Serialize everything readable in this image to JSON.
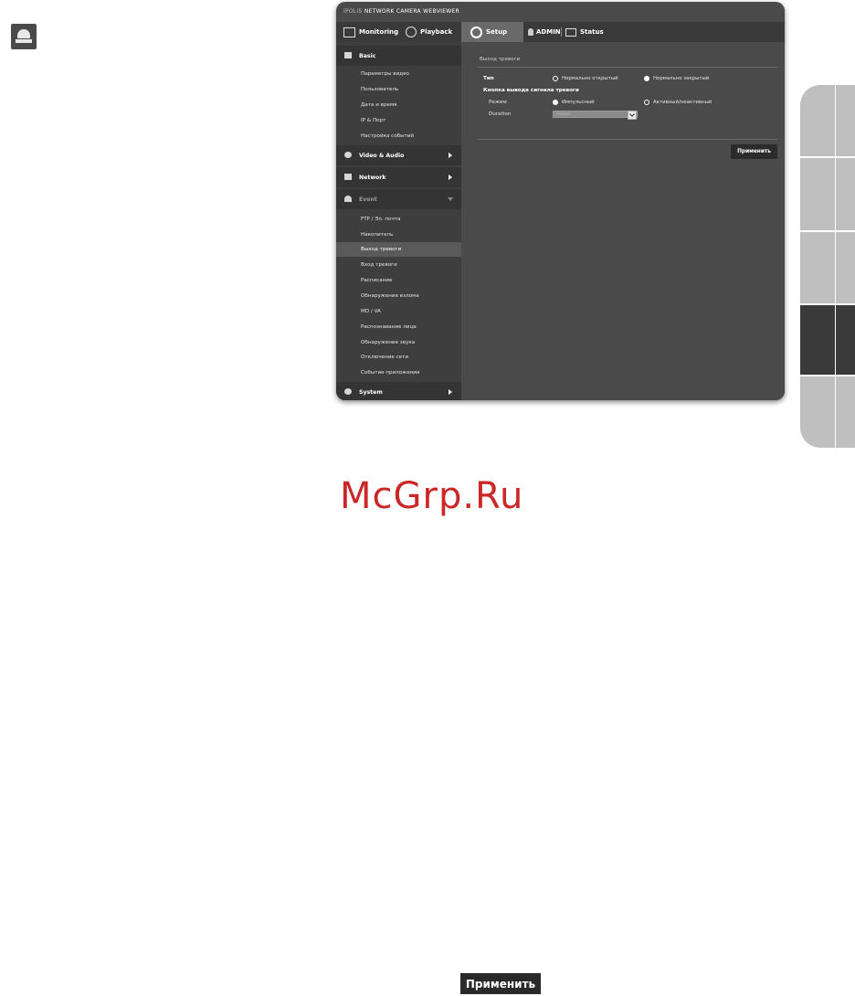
{
  "app": {
    "brand_prefix": "iPOLiS",
    "brand_rest": "NETWORK CAMERA WEBVIEWER",
    "tabs": {
      "monitoring": "Monitoring",
      "playback": "Playback",
      "setup": "Setup",
      "admin": "ADMIN",
      "status": "Status"
    }
  },
  "sidebar": {
    "basic": {
      "label": "Basic",
      "items": [
        "Параметры видео",
        "Пользователь",
        "Дата и время",
        "IP & Порт",
        "Настройка событий"
      ]
    },
    "video_audio": "Video & Audio",
    "network": "Network",
    "event": {
      "label": "Event",
      "items": [
        "FTP / Эл. почта",
        "Накопитель",
        "Выход тревоги",
        "Вход тревоги",
        "Расписание",
        "Обнаружение взлома",
        "MD / VA",
        "Распознавание лица",
        "Обнаружение звука",
        "Отключение сети",
        "Событие приложения"
      ],
      "active_index": 2
    },
    "system": "System"
  },
  "content": {
    "title": "Выход тревоги",
    "type_label": "Тип",
    "type_options": [
      "Нормально открытый",
      "Нормально закрытый"
    ],
    "type_selected": 1,
    "button_label": "Кнопка вывода сигнала тревоги",
    "mode_label": "Режим",
    "mode_options": [
      "Импульсный",
      "Активный/неактивный"
    ],
    "mode_selected": 0,
    "duration_label": "Duration",
    "duration_value": "Always",
    "apply": "Применить"
  },
  "page": {
    "watermark": "McGrp.Ru",
    "apply_big": "Применить"
  }
}
